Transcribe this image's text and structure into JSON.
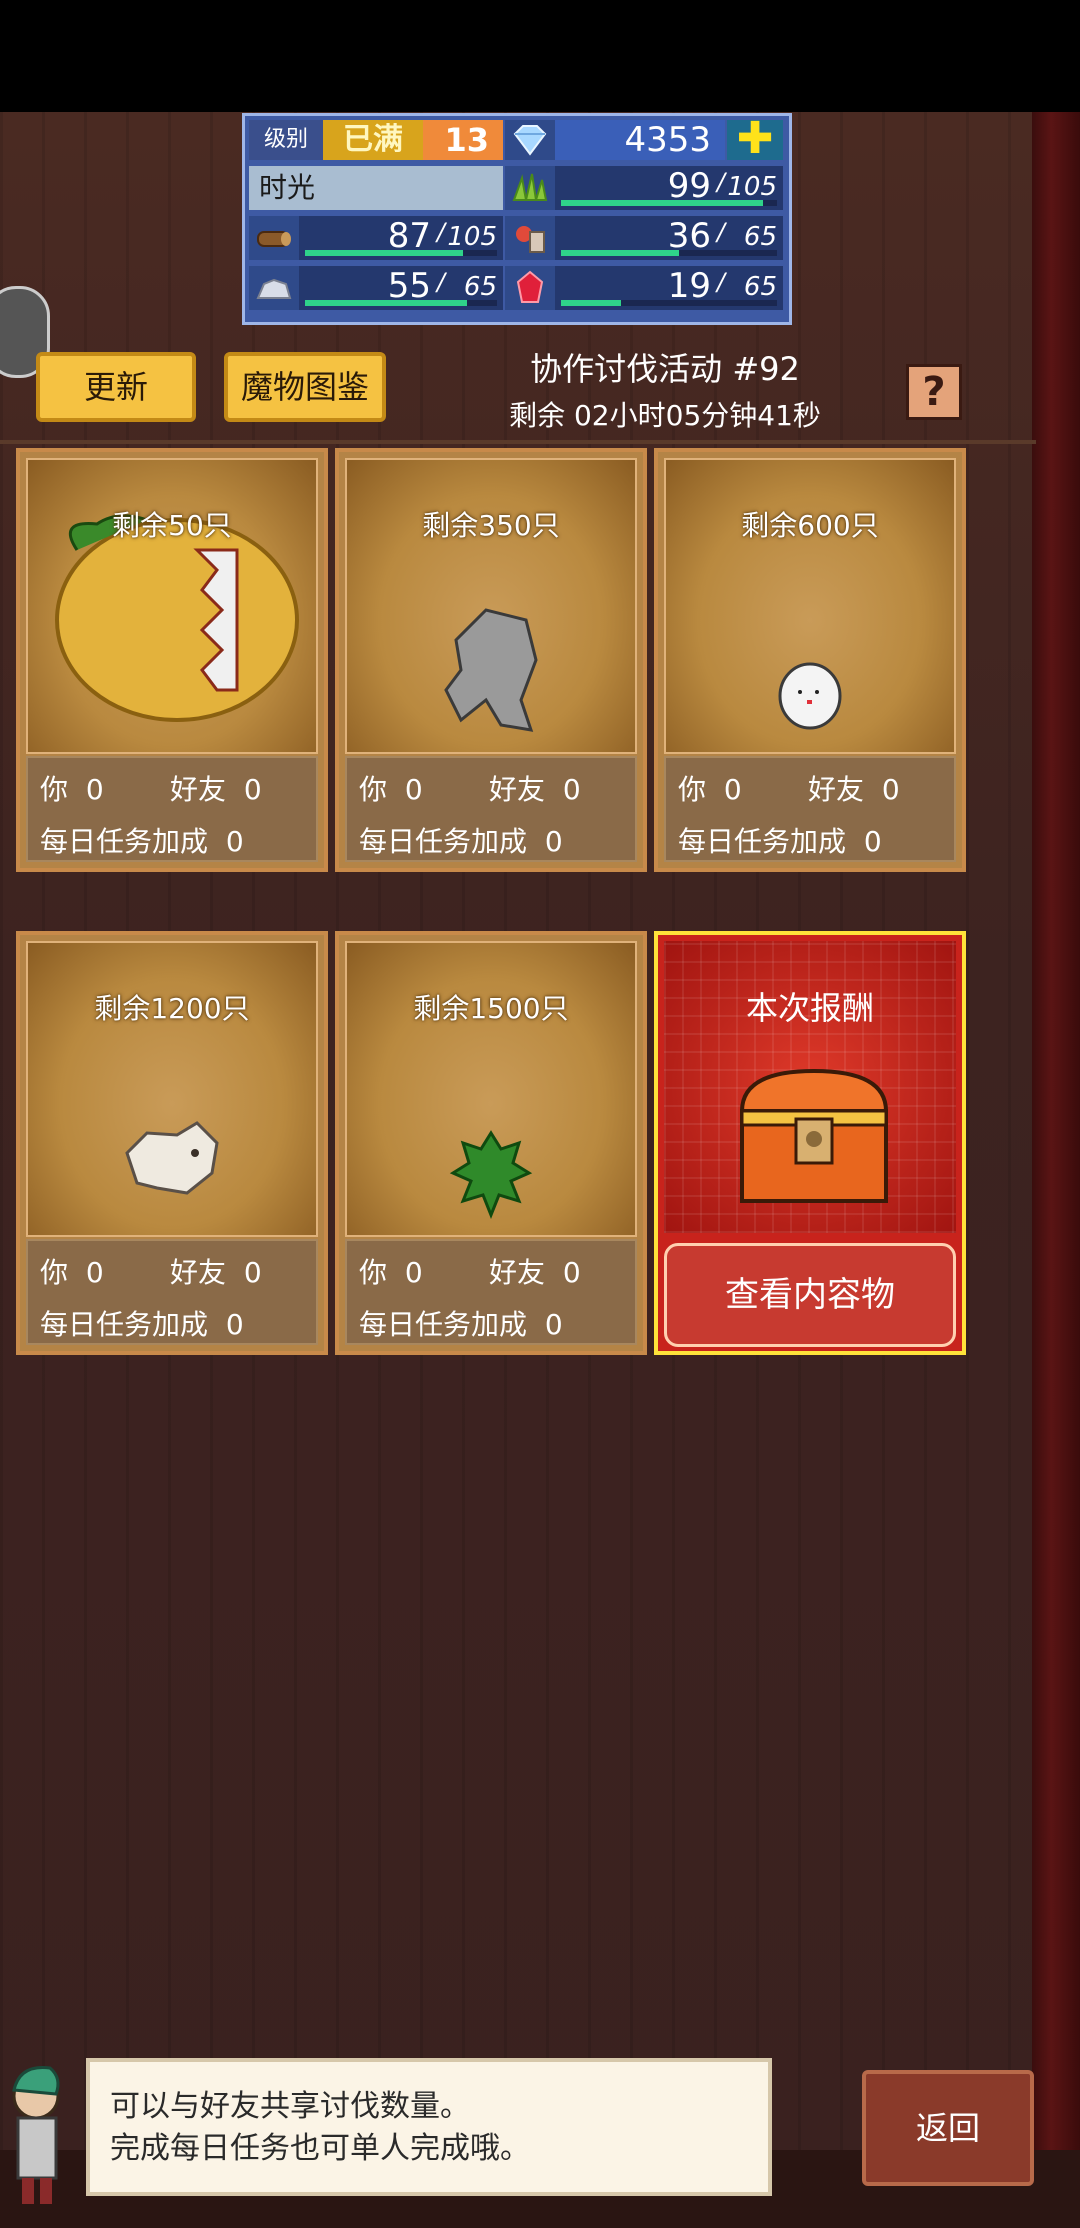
{
  "status": {
    "level_label": "级别",
    "level_max": "已满",
    "level_value": "13",
    "gems": "4353",
    "plus_icon": "plus-icon",
    "name": "时光",
    "resources": [
      {
        "icon": "grass-icon",
        "value": "99",
        "max": "105",
        "fill": 0.94
      },
      {
        "icon": "wood-icon",
        "value": "87",
        "max": "105",
        "fill": 0.83
      },
      {
        "icon": "meat-icon",
        "value": "36",
        "max": "65",
        "fill": 0.55
      },
      {
        "icon": "ore-icon",
        "value": "55",
        "max": "65",
        "fill": 0.85
      },
      {
        "icon": "ruby-icon",
        "value": "19",
        "max": "65",
        "fill": 0.29
      }
    ]
  },
  "toolbar": {
    "refresh_label": "更新",
    "bestiary_label": "魔物图鉴",
    "event_title": "协作讨伐活动 #92",
    "time_remaining": "剩余 02小时05分钟41秒",
    "help_label": "?"
  },
  "cards": [
    {
      "remain": "剩余50只",
      "you_label": "你",
      "you": "0",
      "friend_label": "好友",
      "friend": "0",
      "daily_label": "每日任务加成",
      "daily": "0",
      "monster": "melon-monster"
    },
    {
      "remain": "剩余350只",
      "you_label": "你",
      "you": "0",
      "friend_label": "好友",
      "friend": "0",
      "daily_label": "每日任务加成",
      "daily": "0",
      "monster": "stone-golem"
    },
    {
      "remain": "剩余600只",
      "you_label": "你",
      "you": "0",
      "friend_label": "好友",
      "friend": "0",
      "daily_label": "每日任务加成",
      "daily": "0",
      "monster": "egg-ghost"
    },
    {
      "remain": "剩余1200只",
      "you_label": "你",
      "you": "0",
      "friend_label": "好友",
      "friend": "0",
      "daily_label": "每日任务加成",
      "daily": "0",
      "monster": "bone-beast"
    },
    {
      "remain": "剩余1500只",
      "you_label": "你",
      "you": "0",
      "friend_label": "好友",
      "friend": "0",
      "daily_label": "每日任务加成",
      "daily": "0",
      "monster": "green-bush"
    }
  ],
  "reward": {
    "title": "本次报酬",
    "view_label": "查看内容物",
    "icon": "treasure-chest-icon"
  },
  "dialog": {
    "line1": "可以与好友共享讨伐数量。",
    "line2": "完成每日任务也可单人完成哦。"
  },
  "back_label": "返回"
}
